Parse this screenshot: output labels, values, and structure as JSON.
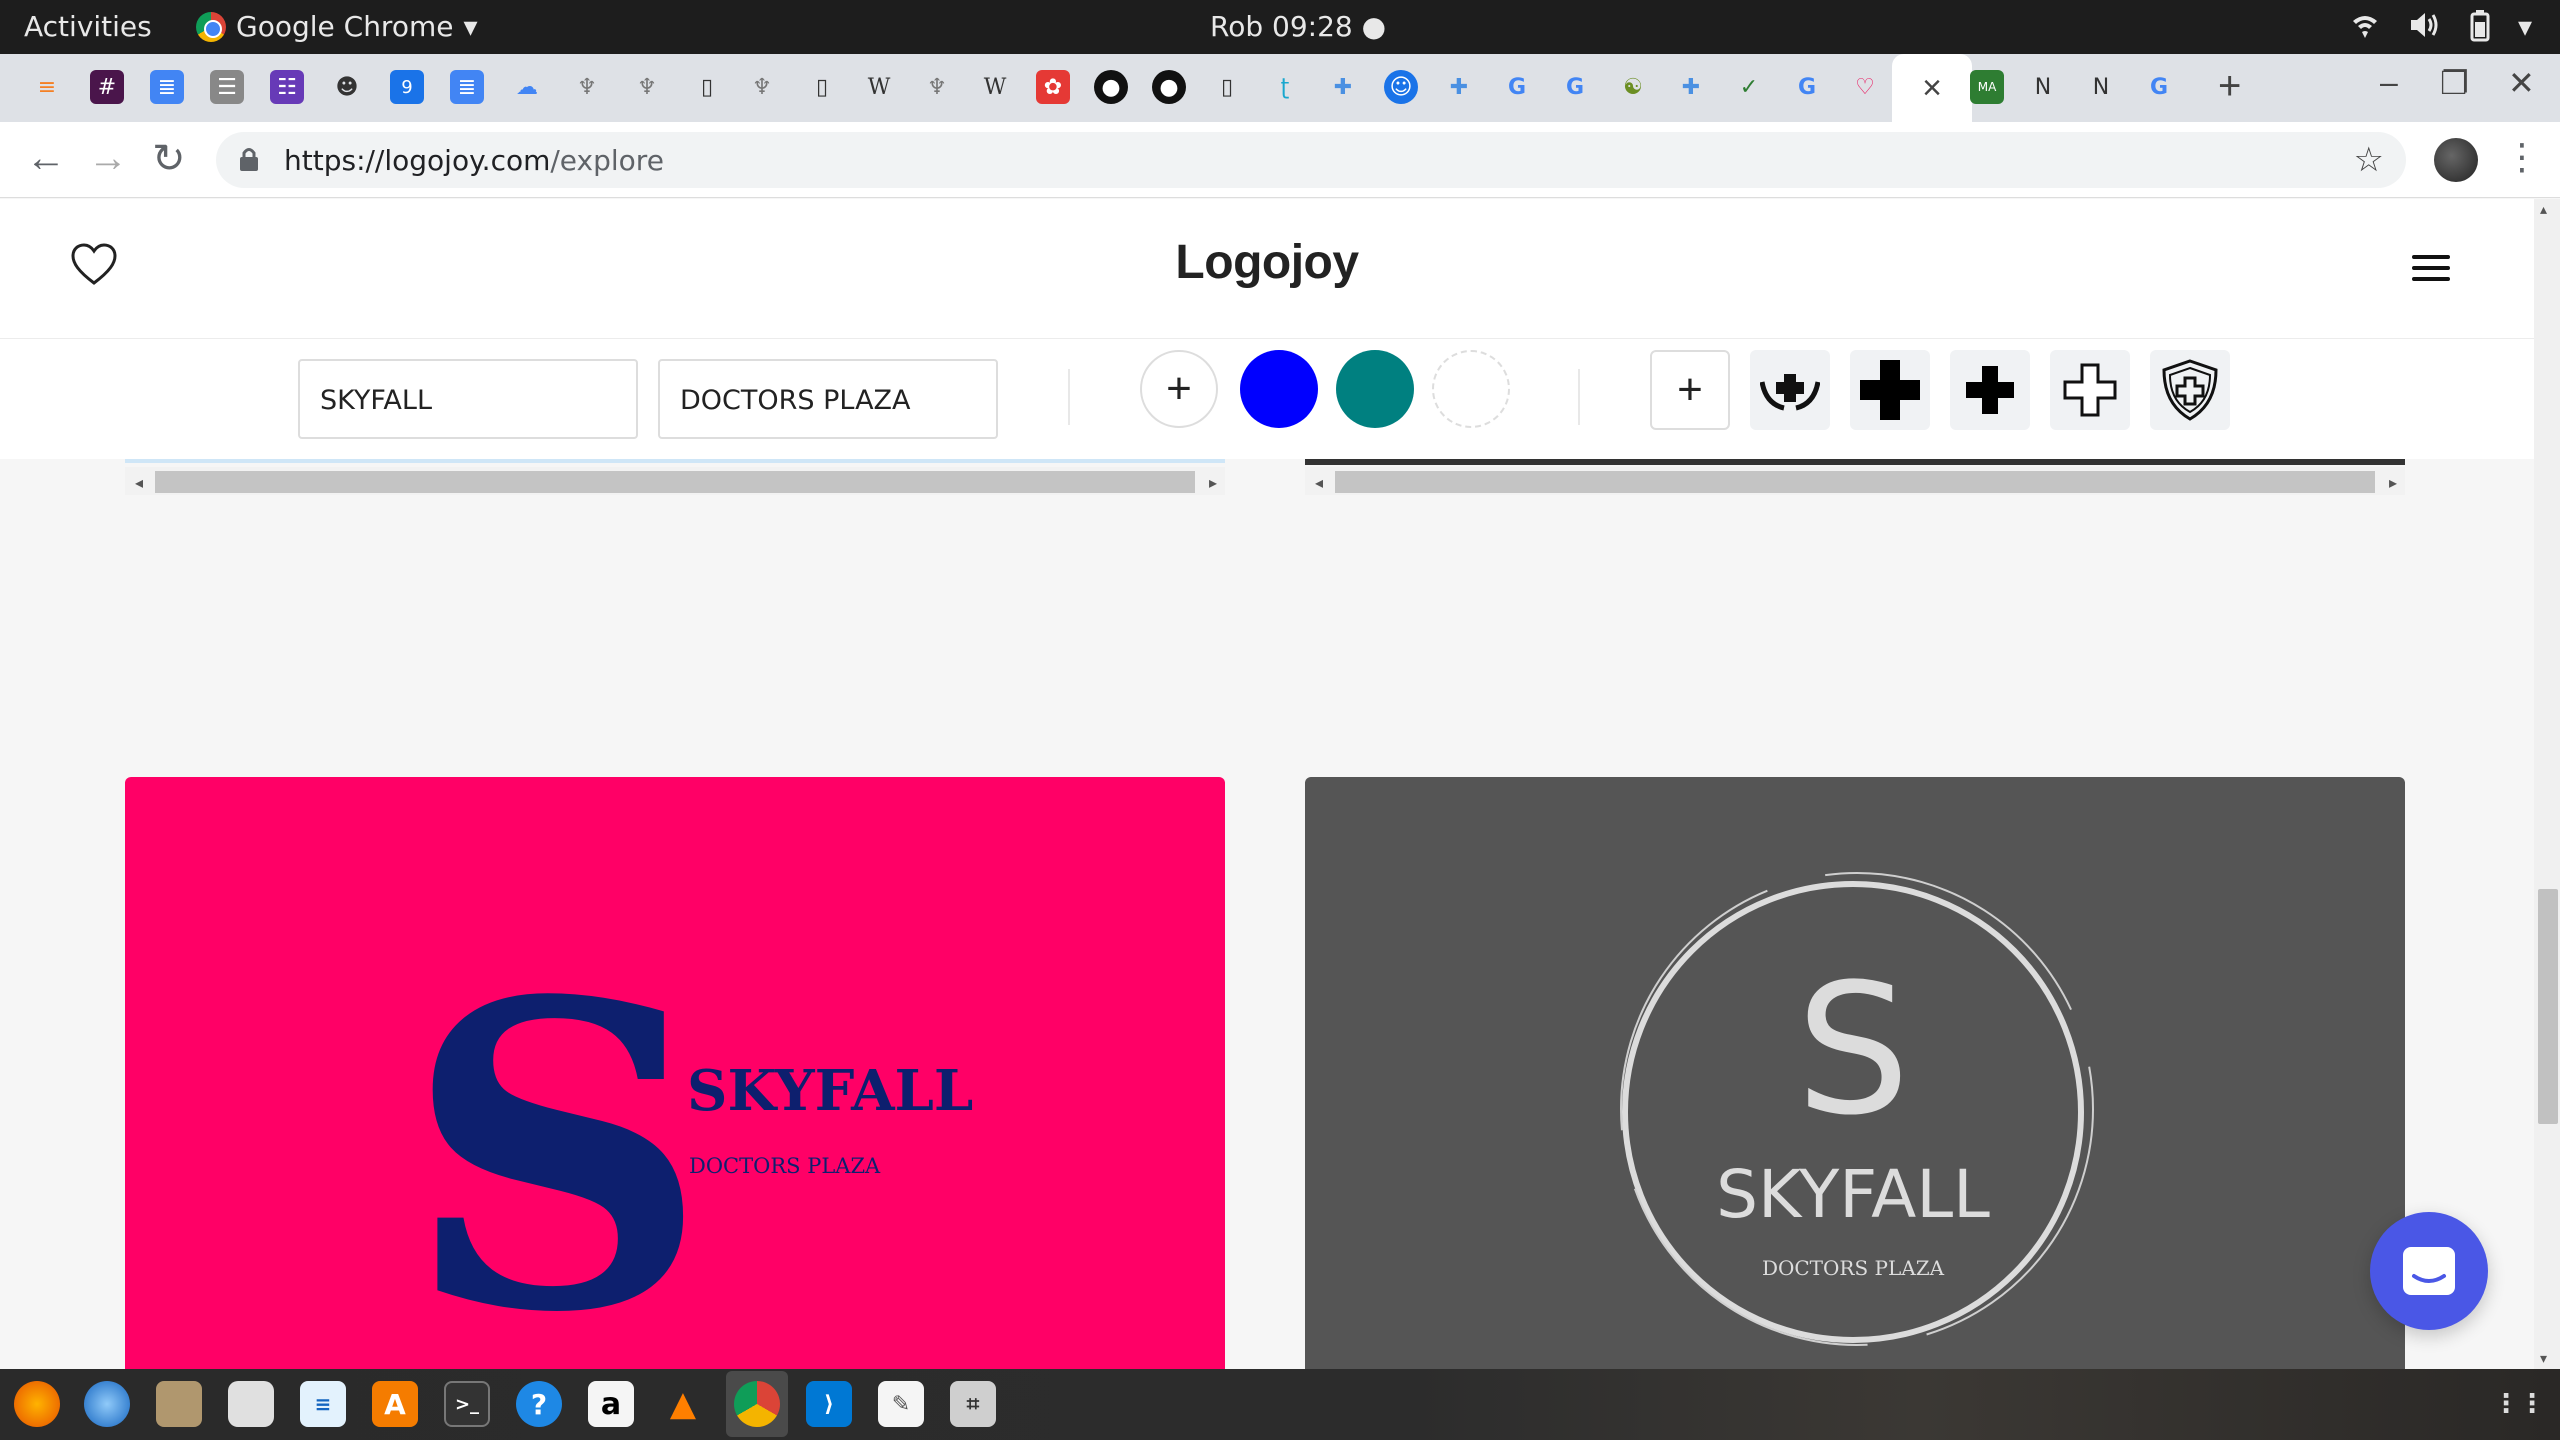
{
  "system": {
    "activities": "Activities",
    "app_name": "Google Chrome",
    "clock": "Rob 09:28 ●",
    "indicators": [
      "wifi-icon",
      "volume-icon",
      "battery-icon",
      "power-menu-icon"
    ]
  },
  "browser": {
    "tab_icons": [
      "stackoverflow-icon",
      "slack-icon",
      "docs-icon",
      "sheets-icon",
      "forms-icon",
      "avatar-icon",
      "calendar-icon",
      "docs-icon",
      "cloud-icon",
      "tree-icon",
      "tree-icon",
      "page-icon",
      "tree-icon",
      "page-icon",
      "wikipedia-icon",
      "tree-icon",
      "wikipedia-icon",
      "openai-icon",
      "github-icon",
      "github-icon",
      "page-icon",
      "tp-icon",
      "plus-icon",
      "contacts-icon",
      "plus-icon",
      "google-icon",
      "google-icon",
      "swirl-icon",
      "plus-icon",
      "check-icon",
      "google-icon",
      "heart-icon"
    ],
    "calendar_day": "9",
    "wiki_letter": "W",
    "active_tab_close": "×",
    "after_tab_icons": [
      "ma-soko-icon",
      "notion-icon",
      "notion-icon",
      "google-icon"
    ],
    "new_tab": "+",
    "url_host": "https://logojoy.com",
    "url_path": "/explore"
  },
  "page": {
    "brand": "Logojoy",
    "company_name": "SKYFALL",
    "slogan": "DOCTORS PLAZA",
    "add_label": "+",
    "colors": [
      "#0000ff",
      "#008080",
      "#ffffff"
    ],
    "symbol_icons": [
      "hands-cross-icon",
      "bold-cross-icon",
      "bold-cross-icon",
      "outline-cross-icon",
      "shield-cross-icon"
    ]
  },
  "logos": [
    {
      "monogram": "S",
      "name": "SKYFALL",
      "tagline": "DOCTORS PLAZA",
      "bg": "#ff0066",
      "fg": "#0d1f6e"
    },
    {
      "monogram": "S",
      "name": "SKYFALL",
      "tagline": "DOCTORS PLAZA",
      "bg": "#555555",
      "fg": "#dcdcdc"
    }
  ],
  "taskbar": [
    "firefox-icon",
    "thunderbird-icon",
    "files-icon",
    "rhythmbox-icon",
    "writer-icon",
    "software-icon",
    "terminal-icon",
    "help-icon",
    "amazon-icon",
    "vlc-icon",
    "chrome-icon",
    "vscode-icon",
    "text-editor-icon",
    "screenshot-icon"
  ],
  "amazon_letter": "a",
  "help_mark": "?",
  "terminal_prompt": ">_"
}
